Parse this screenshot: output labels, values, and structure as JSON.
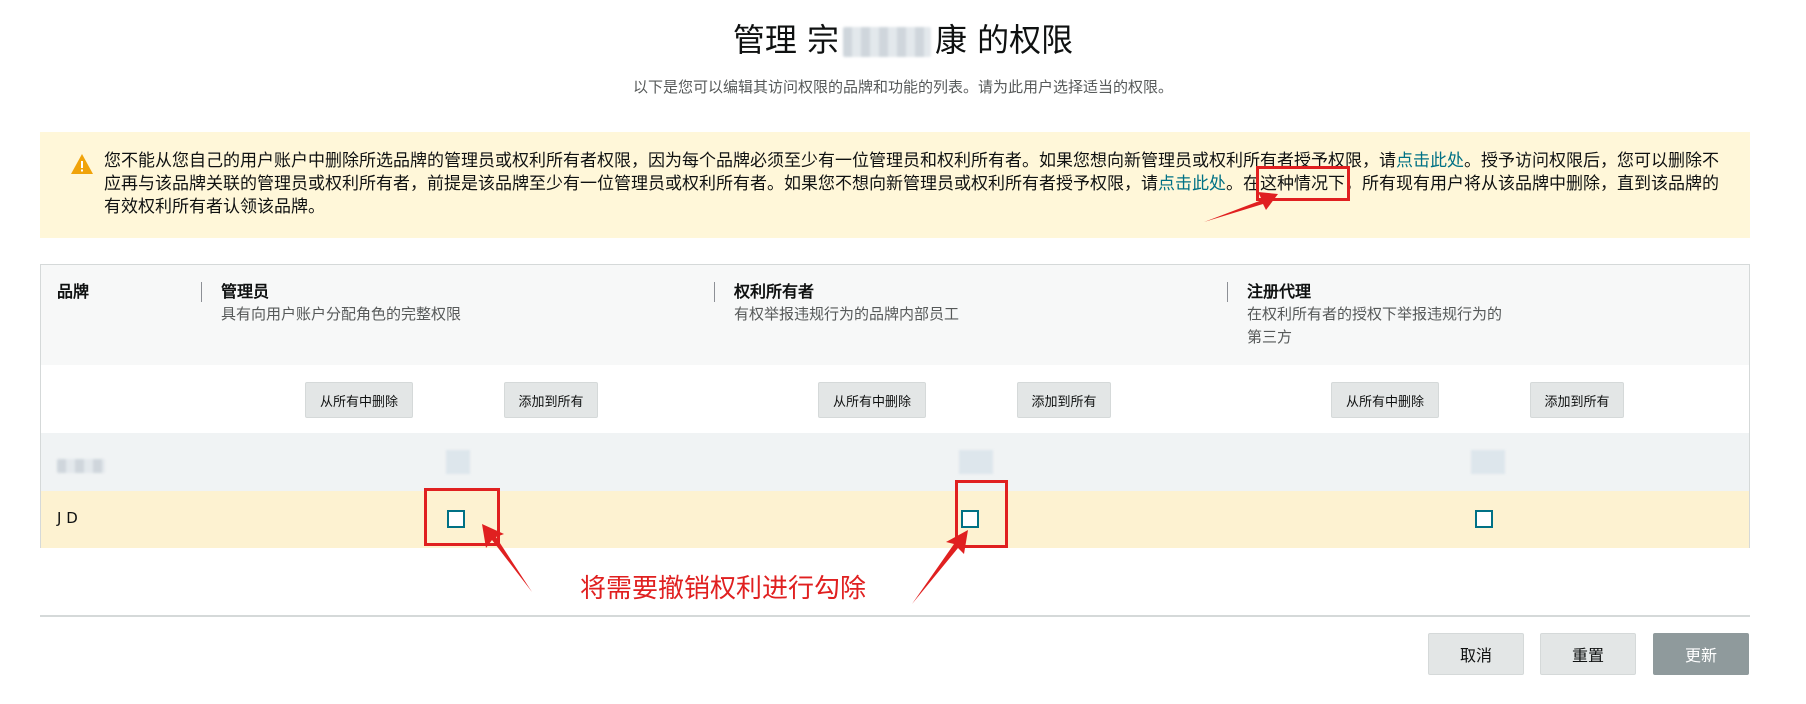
{
  "header": {
    "title_prefix": "管理 宗",
    "title_suffix": "康 的权限",
    "subtitle": "以下是您可以编辑其访问权限的品牌和功能的列表。请为此用户选择适当的权限。"
  },
  "alert": {
    "text_1": "您不能从您自己的用户账户中删除所选品牌的管理员或权利所有者权限，因为每个品牌必须至少有一位管理员和权利所有者。如果您想向新管理员或权利所有者授予权限，请",
    "link_1": "点击此处",
    "text_2": "。授予访问权限后，您可以删除不应再与该品牌关联的管理员或权利所有者，前提是该品牌至少有一位管理员或权利所有者。如果您不想向新管理员或权利所有者授予权限，请",
    "link_2": "点击此处",
    "text_3": "。在这种情况下，所有现有用户将从该品牌中删除，直到该品牌的有效权利所有者认领该品牌。",
    "icon": "warning-icon",
    "color": "#fff7d9"
  },
  "table": {
    "brand_header": "品牌",
    "columns": [
      {
        "name": "管理员",
        "desc": "具有向用户账户分配角色的完整权限",
        "remove_label": "从所有中删除",
        "add_label": "添加到所有"
      },
      {
        "name": "权利所有者",
        "desc": "有权举报违规行为的品牌内部员工",
        "remove_label": "从所有中删除",
        "add_label": "添加到所有"
      },
      {
        "name": "注册代理",
        "desc": "在权利所有者的授权下举报违规行为的第三方",
        "remove_label": "从所有中删除",
        "add_label": "添加到所有"
      }
    ],
    "rows": [
      {
        "brand": "",
        "checked": [
          false,
          false,
          false
        ]
      },
      {
        "brand": "J    D",
        "checked": [
          false,
          false,
          false
        ]
      }
    ]
  },
  "annotation": "将需要撤销权利进行勾除",
  "footer": {
    "cancel_label": "取消",
    "reset_label": "重置",
    "update_label": "更新"
  },
  "colors": {
    "accent": "#007185",
    "annotation_red": "#e02020",
    "selected_row": "#fdf2d1"
  }
}
